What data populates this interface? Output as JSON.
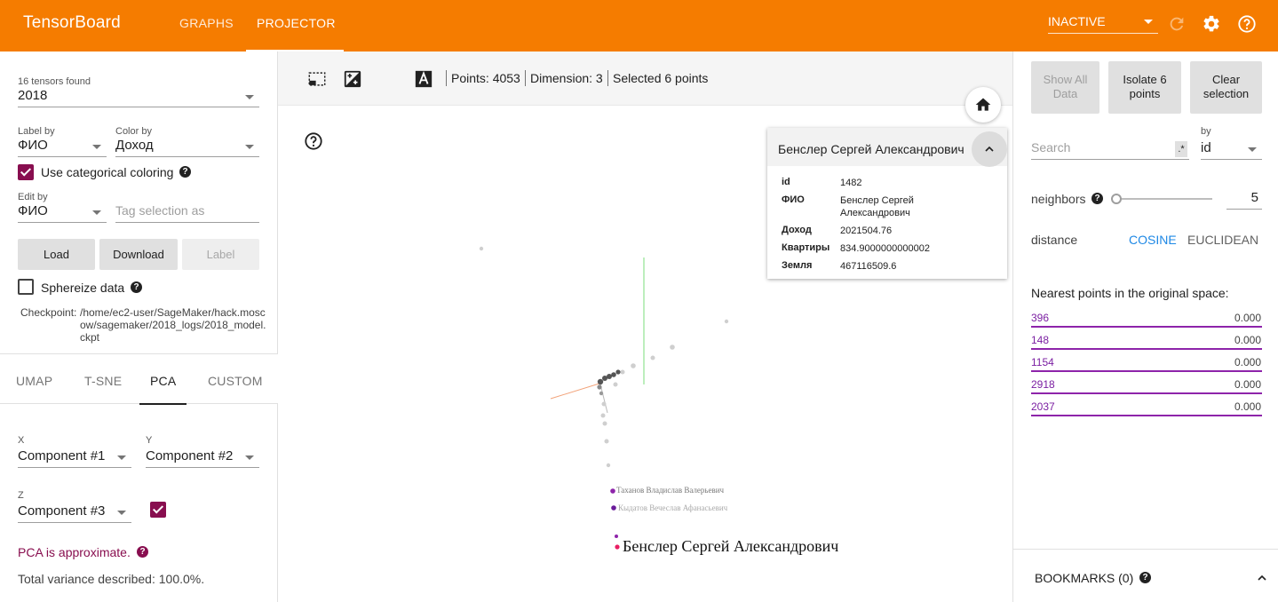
{
  "header": {
    "brand": "TensorBoard",
    "tabs": [
      {
        "label": "GRAPHS"
      },
      {
        "label": "PROJECTOR"
      }
    ],
    "run_selector": "INACTIVE",
    "accent_color": "#f57c00"
  },
  "left_panel": {
    "tensors_found": "16 tensors found",
    "tensor_value": "2018",
    "label_by": {
      "label": "Label by",
      "value": "ФИО"
    },
    "color_by": {
      "label": "Color by",
      "value": "Доход"
    },
    "categorical_coloring": "Use categorical coloring",
    "edit_by": {
      "label": "Edit by",
      "value": "ФИО"
    },
    "tag_placeholder": "Tag selection as",
    "buttons": {
      "load": "Load",
      "download": "Download",
      "label": "Label"
    },
    "sphereize": "Sphereize data",
    "checkpoint_label": "Checkpoint:",
    "checkpoint_path": "/home/ec2-user/SageMaker/hack.moscow/sagemaker/2018_logs/2018_model.ckpt",
    "projection_tabs": [
      "UMAP",
      "T-SNE",
      "PCA",
      "CUSTOM"
    ],
    "pca": {
      "x_label": "X",
      "x_value": "Component #1",
      "y_label": "Y",
      "y_value": "Component #2",
      "z_label": "Z",
      "z_value": "Component #3",
      "approx_note": "PCA is approximate.",
      "variance": "Total variance described: 100.0%."
    }
  },
  "toolbar": {
    "points": "Points: 4053",
    "dimension": "Dimension: 3",
    "selected": "Selected 6 points"
  },
  "scatter": {
    "labels": [
      {
        "text": "Таханов Владислав Валерьевич"
      },
      {
        "text": "Кыдатов Вечеслав Афанасьевич"
      },
      {
        "text": "Бенслер Сергей Александрович"
      }
    ]
  },
  "inspector_card": {
    "title": "Бенслер Сергей Александрович",
    "rows": [
      {
        "key": "id",
        "value": "1482"
      },
      {
        "key": "ФИО",
        "value": "Бенслер Сергей Александрович"
      },
      {
        "key": "Доход",
        "value": "2021504.76"
      },
      {
        "key": "Квартиры",
        "value": "834.9000000000002"
      },
      {
        "key": "Земля",
        "value": "467116509.6"
      }
    ]
  },
  "right_panel": {
    "buttons": {
      "show_all": "Show All Data",
      "isolate": "Isolate 6 points",
      "clear": "Clear selection"
    },
    "search_placeholder": "Search",
    "by_label": "by",
    "by_value": "id",
    "neighbors_label": "neighbors",
    "neighbors_value": "5",
    "distance_label": "distance",
    "distance_options": [
      "COSINE",
      "EUCLIDEAN"
    ],
    "nearest_title": "Nearest points in the original space:",
    "nearest": [
      {
        "id": "396",
        "value": "0.000"
      },
      {
        "id": "148",
        "value": "0.000"
      },
      {
        "id": "1154",
        "value": "0.000"
      },
      {
        "id": "2918",
        "value": "0.000"
      },
      {
        "id": "2037",
        "value": "0.000"
      }
    ],
    "bookmarks": "BOOKMARKS (0)"
  }
}
